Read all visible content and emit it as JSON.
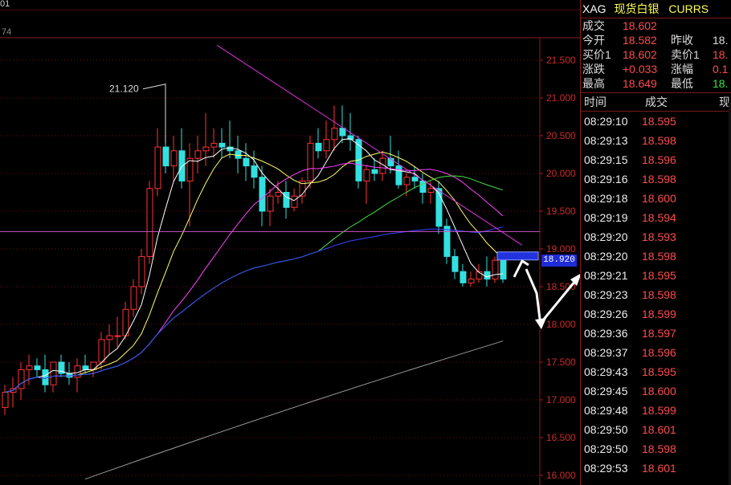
{
  "chart_header": {
    "top_text": "01",
    "sub_text": "74"
  },
  "chart_data": {
    "type": "candlestick",
    "y_ticks": [
      "21.500",
      "21.000",
      "20.500",
      "20.000",
      "19.500",
      "19.000",
      "18.500",
      "18.000",
      "17.500",
      "17.000",
      "16.500",
      "16.000"
    ],
    "ylim": [
      16.0,
      21.5
    ],
    "annotation_high": "21.120",
    "current_price": "18.920",
    "candles": [
      [
        16.9,
        17.2,
        16.8,
        17.1
      ],
      [
        17.1,
        17.3,
        16.9,
        17.15
      ],
      [
        17.15,
        17.5,
        17.0,
        17.4
      ],
      [
        17.4,
        17.6,
        17.2,
        17.45
      ],
      [
        17.45,
        17.55,
        17.3,
        17.4
      ],
      [
        17.4,
        17.6,
        17.1,
        17.2
      ],
      [
        17.2,
        17.5,
        17.1,
        17.5
      ],
      [
        17.5,
        17.6,
        17.3,
        17.35
      ],
      [
        17.35,
        17.5,
        17.2,
        17.3
      ],
      [
        17.3,
        17.55,
        17.1,
        17.45
      ],
      [
        17.45,
        17.6,
        17.35,
        17.4
      ],
      [
        17.4,
        17.5,
        17.3,
        17.5
      ],
      [
        17.5,
        17.9,
        17.4,
        17.8
      ],
      [
        17.8,
        18.0,
        17.6,
        17.85
      ],
      [
        17.85,
        18.1,
        17.7,
        17.85
      ],
      [
        17.85,
        18.3,
        17.8,
        18.2
      ],
      [
        18.2,
        18.6,
        18.1,
        18.5
      ],
      [
        18.5,
        19.0,
        18.4,
        18.9
      ],
      [
        18.9,
        19.9,
        18.8,
        19.8
      ],
      [
        19.8,
        20.6,
        19.7,
        20.35
      ],
      [
        20.35,
        21.12,
        20.0,
        20.1
      ],
      [
        20.1,
        20.5,
        19.9,
        20.3
      ],
      [
        20.3,
        20.6,
        19.8,
        19.9
      ],
      [
        19.9,
        20.4,
        19.3,
        20.2
      ],
      [
        20.2,
        20.5,
        20.0,
        20.3
      ],
      [
        20.3,
        20.8,
        20.1,
        20.35
      ],
      [
        20.35,
        20.6,
        20.2,
        20.4
      ],
      [
        20.4,
        20.6,
        20.2,
        20.35
      ],
      [
        20.35,
        20.7,
        20.2,
        20.3
      ],
      [
        20.3,
        20.5,
        20.0,
        20.2
      ],
      [
        20.2,
        20.4,
        19.9,
        20.1
      ],
      [
        20.1,
        20.3,
        19.8,
        19.95
      ],
      [
        19.95,
        20.1,
        19.3,
        19.5
      ],
      [
        19.5,
        19.8,
        19.3,
        19.7
      ],
      [
        19.7,
        19.9,
        19.6,
        19.75
      ],
      [
        19.75,
        19.9,
        19.4,
        19.55
      ],
      [
        19.55,
        19.8,
        19.5,
        19.7
      ],
      [
        19.7,
        19.95,
        19.6,
        19.9
      ],
      [
        19.9,
        20.5,
        19.8,
        20.4
      ],
      [
        20.4,
        20.6,
        20.2,
        20.3
      ],
      [
        20.3,
        20.7,
        20.2,
        20.45
      ],
      [
        20.45,
        20.9,
        20.3,
        20.6
      ],
      [
        20.6,
        20.9,
        20.4,
        20.5
      ],
      [
        20.5,
        20.8,
        20.3,
        20.45
      ],
      [
        20.45,
        20.5,
        19.8,
        19.9
      ],
      [
        19.9,
        20.1,
        19.6,
        20.05
      ],
      [
        20.05,
        20.2,
        19.9,
        20.0
      ],
      [
        20.0,
        20.3,
        19.9,
        20.2
      ],
      [
        20.2,
        20.5,
        20.0,
        20.1
      ],
      [
        20.1,
        20.3,
        19.8,
        19.85
      ],
      [
        19.85,
        20.0,
        19.7,
        19.95
      ],
      [
        19.95,
        20.1,
        19.8,
        19.9
      ],
      [
        19.9,
        20.0,
        19.6,
        19.75
      ],
      [
        19.75,
        19.9,
        19.6,
        19.8
      ],
      [
        19.8,
        19.9,
        19.2,
        19.3
      ],
      [
        19.3,
        19.4,
        18.8,
        18.9
      ],
      [
        18.9,
        19.0,
        18.6,
        18.7
      ],
      [
        18.7,
        18.8,
        18.5,
        18.55
      ],
      [
        18.55,
        18.7,
        18.5,
        18.6
      ],
      [
        18.6,
        18.8,
        18.55,
        18.7
      ],
      [
        18.7,
        18.9,
        18.5,
        18.6
      ],
      [
        18.6,
        18.9,
        18.55,
        18.85
      ],
      [
        18.85,
        18.95,
        18.55,
        18.6
      ]
    ]
  },
  "panel": {
    "symbol": "XAG",
    "name_cn": "现货白银",
    "currency_label": "CURRS",
    "quote": {
      "deal_label": "成交",
      "deal_value": "18.602",
      "open_label": "今开",
      "open_value": "18.582",
      "prevclose_label": "昨收",
      "prevclose_value": "18.",
      "bid_label": "买价1",
      "bid_value": "18.602",
      "ask_label": "卖价1",
      "ask_value": "18.",
      "change_label": "涨跌",
      "change_value": "+0.033",
      "pct_label": "涨幅",
      "pct_value": "0.1",
      "high_label": "最高",
      "high_value": "18.649",
      "low_label": "最低",
      "low_value": "18."
    },
    "ticks_header": {
      "time": "时间",
      "deal": "成交",
      "now": "现"
    },
    "ticks": [
      {
        "time": "08:29:10",
        "price": "18.595"
      },
      {
        "time": "08:29:13",
        "price": "18.598"
      },
      {
        "time": "08:29:15",
        "price": "18.596"
      },
      {
        "time": "08:29:16",
        "price": "18.598"
      },
      {
        "time": "08:29:18",
        "price": "18.600"
      },
      {
        "time": "08:29:19",
        "price": "18.594"
      },
      {
        "time": "08:29:20",
        "price": "18.593"
      },
      {
        "time": "08:29:20",
        "price": "18.598"
      },
      {
        "time": "08:29:21",
        "price": "18.595"
      },
      {
        "time": "08:29:23",
        "price": "18.598"
      },
      {
        "time": "08:29:26",
        "price": "18.599"
      },
      {
        "time": "08:29:36",
        "price": "18.597"
      },
      {
        "time": "08:29:37",
        "price": "18.596"
      },
      {
        "time": "08:29:43",
        "price": "18.595"
      },
      {
        "time": "08:29:45",
        "price": "18.600"
      },
      {
        "time": "08:29:48",
        "price": "18.599"
      },
      {
        "time": "08:29:50",
        "price": "18.601"
      },
      {
        "time": "08:29:50",
        "price": "18.598"
      },
      {
        "time": "08:29:53",
        "price": "18.601"
      }
    ]
  }
}
